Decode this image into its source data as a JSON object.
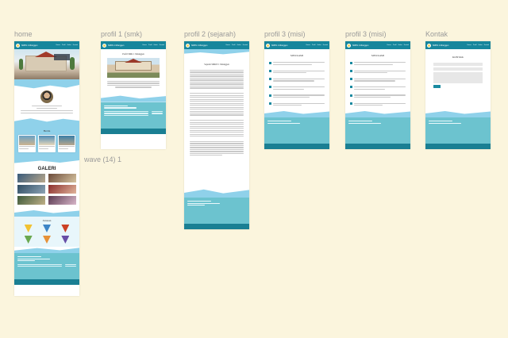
{
  "canvas_bg": "#fbf5dd",
  "labels": {
    "home": "home",
    "profil1": "profil 1 (smk)",
    "profil2": "profil 2 (sejarah)",
    "profil3a": "profil 3 (misi)",
    "profil3b": "profil 3 (misi)",
    "kontak": "Kontak",
    "wave": "wave (14) 1"
  },
  "section_titles": {
    "galeri": "GALERI",
    "jurusan": "Jurusan",
    "misi": "MISI KAMI",
    "kontak": "KONTAK"
  },
  "colors": {
    "nav": "#17869c",
    "wave": "#8fd1ea",
    "footer": "#6cc3cf",
    "footer_bar": "#1a7f93"
  }
}
